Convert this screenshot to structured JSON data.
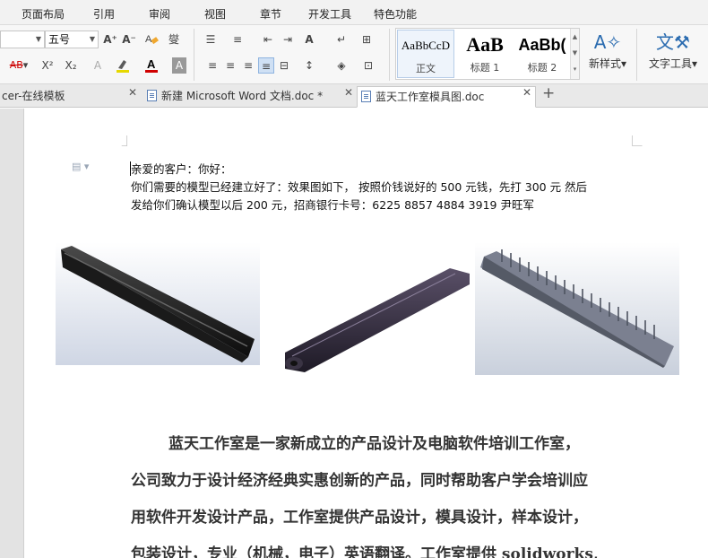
{
  "menu": [
    "页面布局",
    "引用",
    "审阅",
    "视图",
    "章节",
    "开发工具",
    "特色功能"
  ],
  "ribbon": {
    "font_size": "五号",
    "grow_font": "A⁺",
    "shrink_font": "A⁻",
    "clear_format_icon": "eraser-icon",
    "phonetic": "燮",
    "strike_format": "AB",
    "superscript": "X²",
    "subscript": "X₂",
    "styles": [
      {
        "preview": "AaBbCcD",
        "name": "正文"
      },
      {
        "preview": "AaB",
        "name": "标题 1"
      },
      {
        "preview": "AaBb(",
        "name": "标题 2"
      }
    ],
    "new_style": "新样式",
    "text_tools": "文字工具",
    "accent_color": "#2b6cb0",
    "font_color": "#d00000",
    "highlight_color": "#e6d800"
  },
  "tabs": [
    {
      "label": "cer-在线模板"
    },
    {
      "label": "新建 Microsoft Word 文档.doc *"
    },
    {
      "label": "蓝天工作室模具图.doc"
    }
  ],
  "new_tab": "+",
  "letter": {
    "line1": "亲爱的客户：你好：",
    "line2": "你们需要的模型已经建立好了：效果图如下， 按照价钱说好的 500 元钱，先打 300 元  然后",
    "line3": "发给你们确认模型以后 200 元，招商银行卡号：6225 8857 4884 3919  尹旺军"
  },
  "body": {
    "line1": "蓝天工作室是一家新成立的产品设计及电脑软件培训工作室，",
    "line2": "公司致力于设计经济经典实惠创新的产品，同时帮助客户学会培训应",
    "line3": "用软件开发设计产品，工作室提供产品设计，模具设计，样本设计，",
    "line4": "包装设计，专业（机械，电子）英语翻译。工作室提供 solidworks,"
  }
}
